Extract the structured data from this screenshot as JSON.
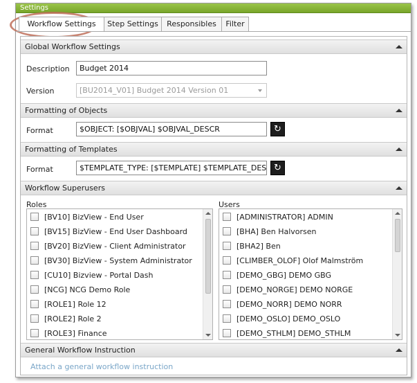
{
  "window": {
    "title": "Settings"
  },
  "tabs": [
    {
      "label": "Workflow Settings",
      "active": true
    },
    {
      "label": "Step Settings",
      "active": false
    },
    {
      "label": "Responsibles",
      "active": false
    },
    {
      "label": "Filter",
      "active": false
    }
  ],
  "global": {
    "header": "Global Workflow Settings",
    "description_label": "Description",
    "description_value": "Budget 2014",
    "version_label": "Version",
    "version_value": "[BU2014_V01] Budget 2014 Version 01"
  },
  "objects": {
    "header": "Formatting of Objects",
    "format_label": "Format",
    "format_value": "$OBJECT: [$OBJVAL] $OBJVAL_DESCR"
  },
  "templates": {
    "header": "Formatting of Templates",
    "format_label": "Format",
    "format_value": "$TEMPLATE_TYPE: [$TEMPLATE] $TEMPLATE_DESC"
  },
  "superusers": {
    "header": "Workflow Superusers",
    "roles_label": "Roles",
    "users_label": "Users",
    "roles": [
      "[BV10] BizView - End User",
      "[BV15] BizView - End User Dashboard",
      "[BV20] BizView - Client Administrator",
      "[BV30] BizView - System Administrator",
      "[CU10] Bizview - Portal Dash",
      "[NCG] NCG Demo Role",
      "[ROLE1] Role 12",
      "[ROLE2] Role 2",
      "[ROLE3] Finance"
    ],
    "users": [
      "[ADMINISTRATOR] ADMIN",
      "[BHA] Ben Halvorsen",
      "[BHA2] Ben",
      "[CLIMBER_OLOF] Olof Malmström",
      "[DEMO_GBG] DEMO GBG",
      "[DEMO_NORGE] DEMO NORGE",
      "[DEMO_NORR] DEMO NORR",
      "[DEMO_OSLO] DEMO_OSLO",
      "[DEMO_STHLM] DEMO_STHLM"
    ]
  },
  "instruction": {
    "header": "General Workflow Instruction",
    "link": "Attach a general workflow instruction"
  },
  "icons": {
    "collapse": "chevron-up-icon",
    "refresh": "refresh-icon",
    "checkbox": "checkbox-icon"
  },
  "colors": {
    "titlebar": "#8ab83a",
    "link": "#7aa6c8",
    "highlight": "#c0705a"
  }
}
